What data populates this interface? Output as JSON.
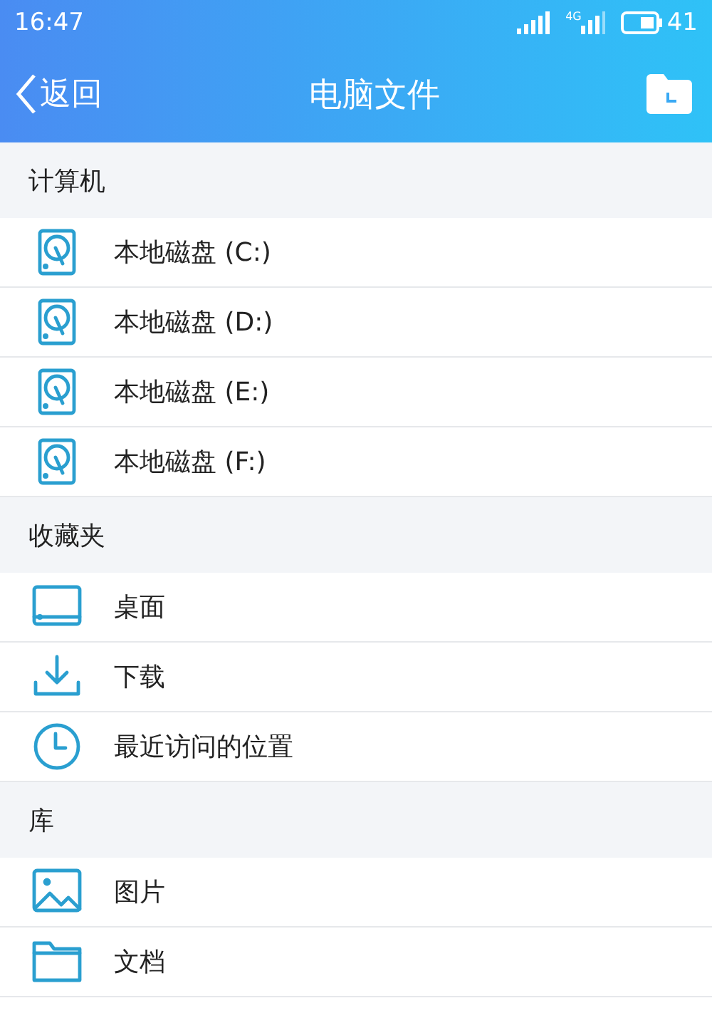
{
  "status_bar": {
    "time": "16:47",
    "network_label": "4G",
    "battery": "41"
  },
  "header": {
    "back": "返回",
    "title": "电脑文件"
  },
  "sections": [
    {
      "title": "计算机",
      "items": [
        {
          "kind": "disk",
          "label": "本地磁盘 (C:)"
        },
        {
          "kind": "disk",
          "label": "本地磁盘 (D:)"
        },
        {
          "kind": "disk",
          "label": "本地磁盘 (E:)"
        },
        {
          "kind": "disk",
          "label": "本地磁盘 (F:)"
        }
      ]
    },
    {
      "title": "收藏夹",
      "items": [
        {
          "kind": "desktop",
          "label": "桌面"
        },
        {
          "kind": "download",
          "label": "下载"
        },
        {
          "kind": "recent",
          "label": "最近访问的位置"
        }
      ]
    },
    {
      "title": "库",
      "items": [
        {
          "kind": "picture",
          "label": "图片"
        },
        {
          "kind": "folder",
          "label": "文档"
        }
      ]
    }
  ]
}
